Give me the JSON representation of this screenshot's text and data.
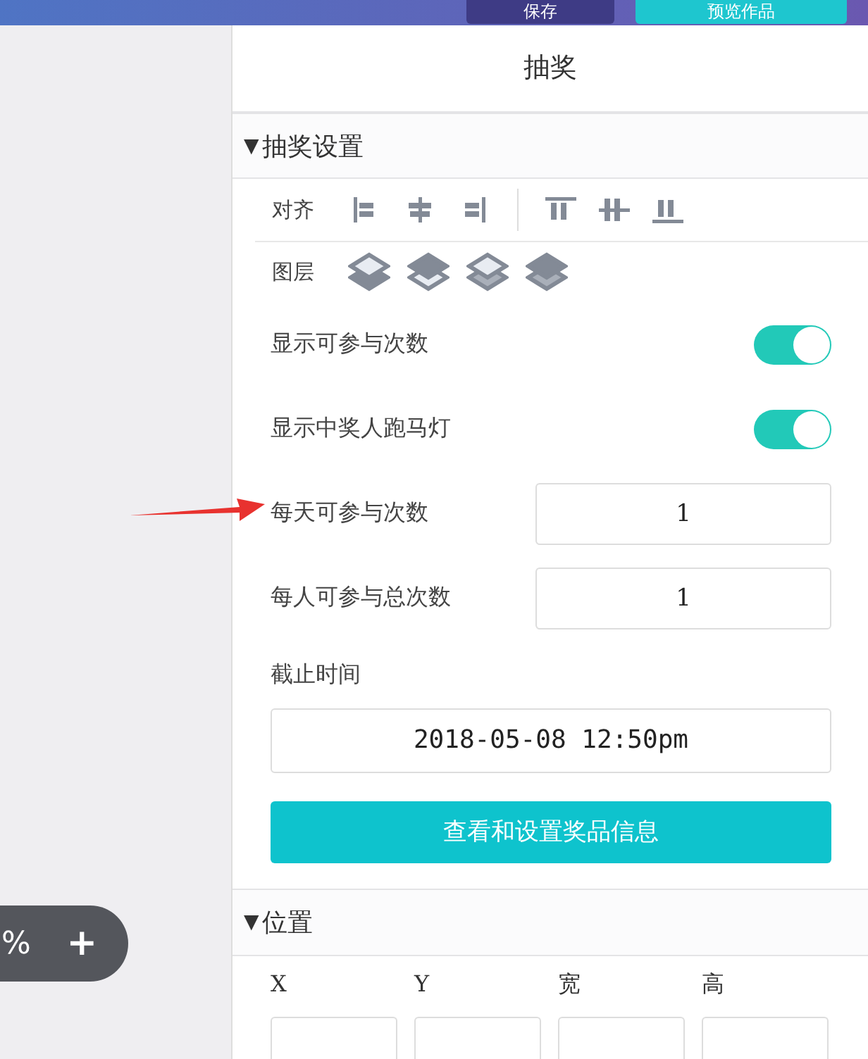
{
  "top_bar": {
    "buttons": [
      {
        "label": "保存",
        "kind": "save"
      },
      {
        "label": "预览作品",
        "kind": "preview"
      }
    ]
  },
  "zoom_control": {
    "reading": "%",
    "plus": "+"
  },
  "panel": {
    "title": "抽奖"
  },
  "lottery_section": {
    "title": "抽奖设置",
    "expanded": true,
    "arrow": "▼",
    "align_label": "对齐",
    "layer_label": "图层",
    "settings": [
      {
        "kind": "toggle",
        "label": "显示可参与次数",
        "on": true,
        "annotated": false
      },
      {
        "kind": "toggle",
        "label": "显示中奖人跑马灯",
        "on": true,
        "annotated": false
      },
      {
        "kind": "number",
        "label": "每天可参与次数",
        "value": "1",
        "annotated": true
      },
      {
        "kind": "number",
        "label": "每人可参与总次数",
        "value": "1",
        "annotated": false
      }
    ],
    "deadline_label": "截止时间",
    "deadline_value": "2018-05-08 12:50pm",
    "prize_button": "查看和设置奖品信息"
  },
  "position_section": {
    "title": "位置",
    "expanded": true,
    "arrow": "▼",
    "fields": [
      "X",
      "Y",
      "宽",
      "高"
    ]
  }
}
